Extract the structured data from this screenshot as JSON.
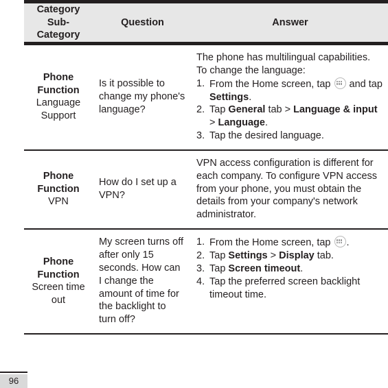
{
  "table": {
    "headers": {
      "category": [
        "Category",
        "Sub-",
        "Category"
      ],
      "question": "Question",
      "answer": "Answer"
    },
    "rows": [
      {
        "category_main": "Phone Function",
        "category_sub": "Language Support",
        "question": "Is it possible to change my phone's language?",
        "answer": {
          "intro": [
            "The phone has multilingual capabilities.",
            "To change the language:"
          ],
          "steps": [
            {
              "num": "1.",
              "parts": [
                {
                  "text": "From the Home screen, tap ",
                  "bold": false
                },
                {
                  "icon": "app-grid-icon"
                },
                {
                  "text": " and tap ",
                  "bold": false
                },
                {
                  "text": "Settings",
                  "bold": true
                },
                {
                  "text": ".",
                  "bold": false
                }
              ]
            },
            {
              "num": "2.",
              "parts": [
                {
                  "text": "Tap ",
                  "bold": false
                },
                {
                  "text": "General",
                  "bold": true
                },
                {
                  "text": " tab > ",
                  "bold": false
                },
                {
                  "text": "Language & input",
                  "bold": true
                },
                {
                  "text": " > ",
                  "bold": false
                },
                {
                  "text": "Language",
                  "bold": true
                },
                {
                  "text": ".",
                  "bold": false
                }
              ]
            },
            {
              "num": "3.",
              "parts": [
                {
                  "text": "Tap the desired language.",
                  "bold": false
                }
              ]
            }
          ]
        }
      },
      {
        "category_main": "Phone Function",
        "category_sub": "VPN",
        "question": "How do I set up a VPN?",
        "answer": {
          "intro": [
            "VPN access configuration is different for each company. To configure VPN access from your phone, you must obtain the details from your company's network administrator."
          ],
          "steps": []
        }
      },
      {
        "category_main": "Phone Function",
        "category_sub": "Screen time out",
        "question": "My screen turns off after only 15 seconds. How can I change the amount of time for the backlight to turn off?",
        "answer": {
          "intro": [],
          "steps": [
            {
              "num": "1.",
              "parts": [
                {
                  "text": "From the Home screen, tap ",
                  "bold": false
                },
                {
                  "icon": "app-grid-icon"
                },
                {
                  "text": ".",
                  "bold": false
                }
              ]
            },
            {
              "num": "2.",
              "parts": [
                {
                  "text": "Tap ",
                  "bold": false
                },
                {
                  "text": "Settings",
                  "bold": true
                },
                {
                  "text": " > ",
                  "bold": false
                },
                {
                  "text": "Display",
                  "bold": true
                },
                {
                  "text": " tab.",
                  "bold": false
                }
              ]
            },
            {
              "num": "3.",
              "parts": [
                {
                  "text": "Tap ",
                  "bold": false
                },
                {
                  "text": "Screen timeout",
                  "bold": true
                },
                {
                  "text": ".",
                  "bold": false
                }
              ]
            },
            {
              "num": "4.",
              "parts": [
                {
                  "text": "Tap the preferred screen backlight timeout time.",
                  "bold": false
                }
              ]
            }
          ]
        }
      }
    ]
  },
  "footer": {
    "page_number": "96"
  },
  "colors": {
    "header_bg": "#e7e7e7",
    "rule": "#231f20",
    "text": "#231f20",
    "footer_bg": "#d9d9d9",
    "icon_stroke": "#b9b9b9"
  }
}
